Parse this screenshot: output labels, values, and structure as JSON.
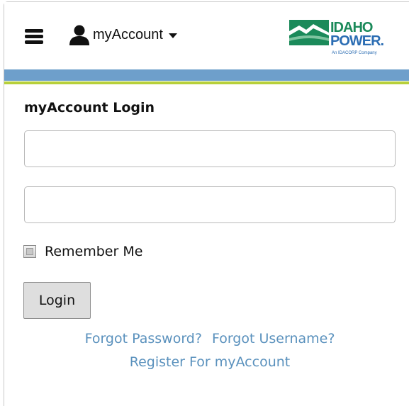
{
  "header": {
    "account_label": "myAccount",
    "logo": {
      "line1": "IDAHO",
      "line2": "POWER.",
      "tagline": "An IDACORP Company"
    }
  },
  "colors": {
    "blue_bar": "#6e9fcb",
    "green_bar": "#b7d03a",
    "link": "#5a91bd",
    "logo_green": "#1b8a5a",
    "logo_blue": "#2b6db3"
  },
  "login": {
    "title": "myAccount Login",
    "username_value": "",
    "password_value": "",
    "remember_label": "Remember Me",
    "login_button": "Login",
    "forgot_password": "Forgot Password?",
    "forgot_username": "Forgot Username?",
    "register": "Register For myAccount"
  },
  "icons": [
    "hamburger-menu-icon",
    "person-icon",
    "caret-down-icon",
    "idaho-power-logo"
  ]
}
